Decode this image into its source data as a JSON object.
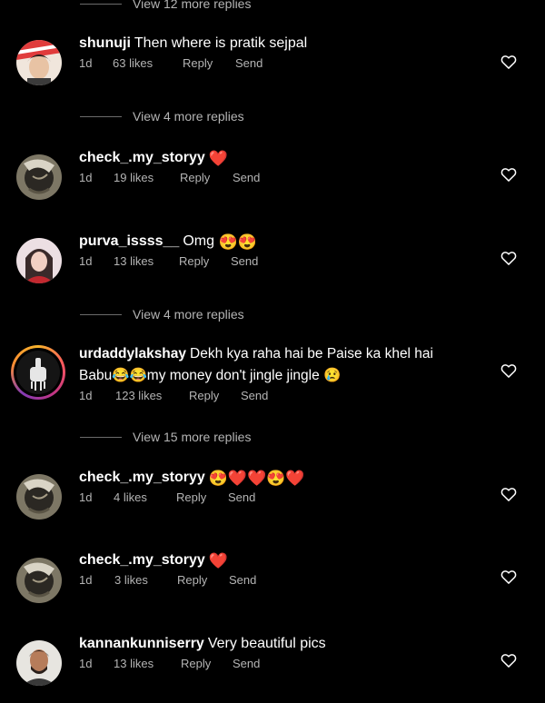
{
  "view_replies": [
    {
      "label": "View 12 more replies"
    },
    {
      "label": "View 4 more replies"
    },
    {
      "label": "View 4 more replies"
    },
    {
      "label": "View 15 more replies"
    }
  ],
  "comments": [
    {
      "username": "shunuji",
      "text": "Then where is pratik sejpal",
      "emoji": "",
      "time": "1d",
      "likes": "63 likes",
      "reply": "Reply",
      "send": "Send"
    },
    {
      "username": "check_.my_storyy",
      "text": "",
      "emoji": "❤️",
      "time": "1d",
      "likes": "19 likes",
      "reply": "Reply",
      "send": "Send"
    },
    {
      "username": "purva_issss__",
      "text": "Omg",
      "emoji": "😍😍",
      "time": "1d",
      "likes": "13 likes",
      "reply": "Reply",
      "send": "Send"
    },
    {
      "username": "urdaddylakshay",
      "text": "Dekh kya raha hai be Paise ka khel hai Babu😂😂my money don't jingle jingle 😢",
      "emoji": "",
      "time": "1d",
      "likes": "123 likes",
      "reply": "Reply",
      "send": "Send"
    },
    {
      "username": "check_.my_storyy",
      "text": "",
      "emoji": "😍❤️❤️😍❤️",
      "time": "1d",
      "likes": "4 likes",
      "reply": "Reply",
      "send": "Send"
    },
    {
      "username": "check_.my_storyy",
      "text": "",
      "emoji": "❤️",
      "time": "1d",
      "likes": "3 likes",
      "reply": "Reply",
      "send": "Send"
    },
    {
      "username": "kannankunniserry",
      "text": "Very beautiful pics",
      "emoji": "",
      "time": "1d",
      "likes": "13 likes",
      "reply": "Reply",
      "send": "Send"
    }
  ],
  "icons": {
    "like": "heart-outline-icon"
  },
  "colors": {
    "background": "#000000",
    "text": "#ffffff",
    "muted": "#b4b4b4",
    "heart_emoji": "#e8302f"
  }
}
